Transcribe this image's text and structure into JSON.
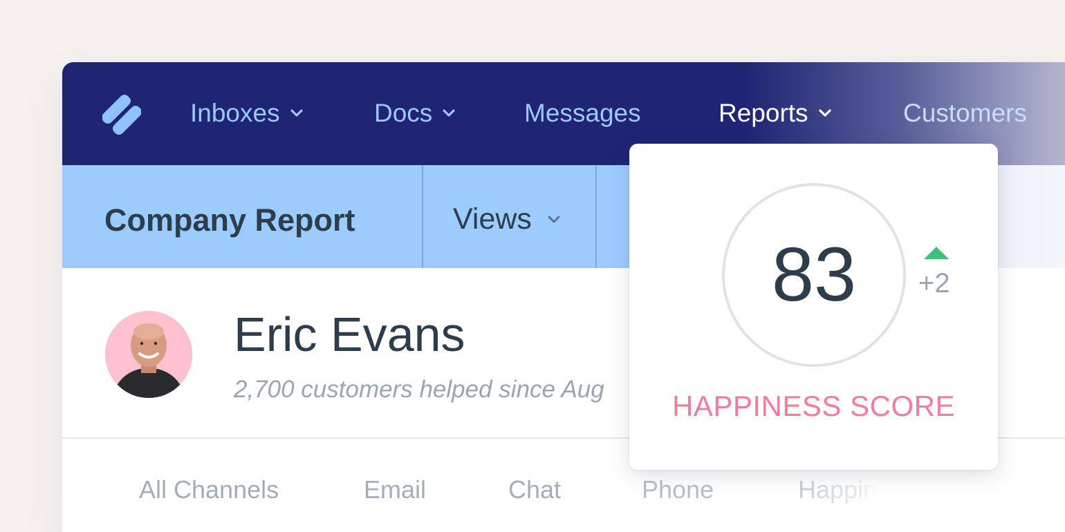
{
  "nav": {
    "items": [
      {
        "label": "Inboxes",
        "has_dropdown": true,
        "active": false
      },
      {
        "label": "Docs",
        "has_dropdown": true,
        "active": false
      },
      {
        "label": "Messages",
        "has_dropdown": false,
        "active": false
      },
      {
        "label": "Reports",
        "has_dropdown": true,
        "active": true
      },
      {
        "label": "Customers",
        "has_dropdown": false,
        "active": false
      }
    ],
    "logo_icon": "helpscout-logo-icon"
  },
  "subbar": {
    "title": "Company Report",
    "views_label": "Views"
  },
  "profile": {
    "name": "Eric Evans",
    "subtitle": "2,700 customers helped since Aug"
  },
  "tabs": [
    "All Channels",
    "Email",
    "Chat",
    "Phone",
    "Happin"
  ],
  "happiness_card": {
    "score": "83",
    "delta": "+2",
    "trend": "up",
    "label": "HAPPINESS SCORE"
  },
  "colors": {
    "nav_bg": "#1f2574",
    "nav_link": "#9dc8fb",
    "subbar_bg": "#9ccbfd",
    "accent_pink": "#f27c9a",
    "trend_green": "#3ec177",
    "text_dark": "#2e3d4c"
  }
}
